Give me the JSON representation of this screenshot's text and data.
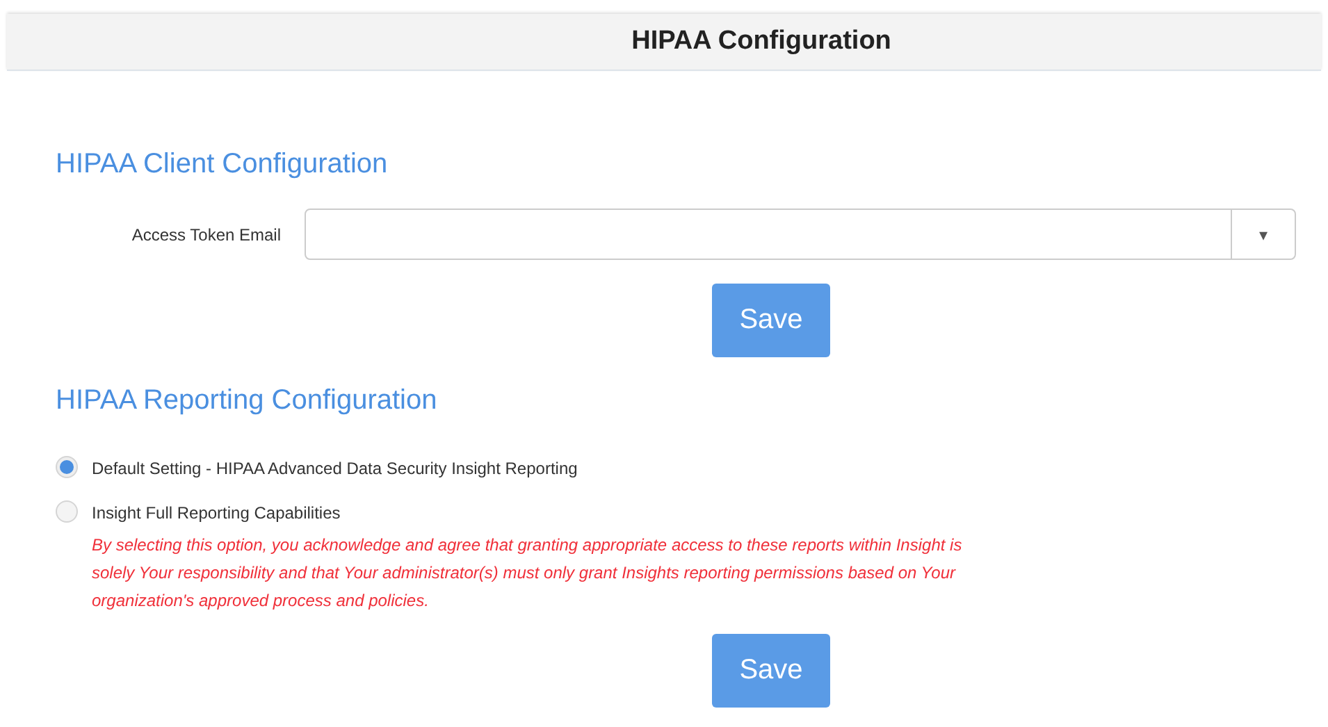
{
  "header": {
    "title": "HIPAA Configuration"
  },
  "client_config": {
    "title": "HIPAA Client Configuration",
    "field": {
      "label": "Access Token Email",
      "caret": "▾"
    },
    "save_button": "Save"
  },
  "reporting_config": {
    "title": "HIPAA Reporting Configuration",
    "options": [
      {
        "label": "Default Setting - HIPAA Advanced Data Security Insight Reporting",
        "selected": true
      },
      {
        "label": "Insight Full Reporting Capabilities",
        "selected": false,
        "warning": "By selecting this option, you acknowledge and agree that granting appropriate access to these reports within Insight is solely Your responsibility and that Your administrator(s) must only grant Insights reporting permissions based on Your organization's approved process and policies."
      }
    ],
    "save_button": "Save"
  }
}
